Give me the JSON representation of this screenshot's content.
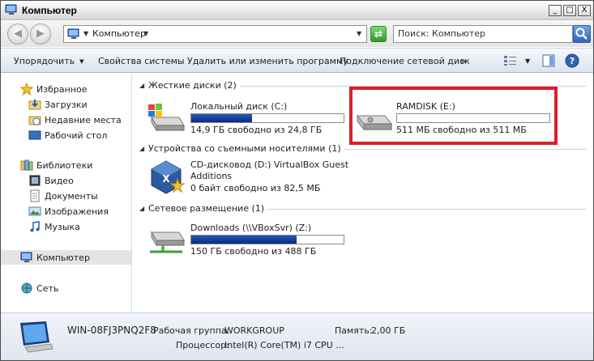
{
  "window": {
    "title": "Компьютер",
    "minimize": "_",
    "maximize": "□",
    "close": "X"
  },
  "address": {
    "path": "Компьютер",
    "search_placeholder": "Поиск: Компьютер"
  },
  "toolbar": {
    "organize": "Упорядочить",
    "system_properties": "Свойства системы",
    "uninstall": "Удалить или изменить программу",
    "map_drive": "Подключение сетевой диск",
    "more": "»"
  },
  "nav": {
    "favorites": "Избранное",
    "downloads": "Загрузки",
    "recent": "Недавние места",
    "desktop": "Рабочий стол",
    "libraries": "Библиотеки",
    "video": "Видео",
    "documents": "Документы",
    "images": "Изображения",
    "music": "Музыка",
    "computer": "Компьютер",
    "network": "Сеть"
  },
  "groups": {
    "hdd": "Жесткие диски (2)",
    "removable": "Устройства со съемными носителями (1)",
    "network": "Сетевое размещение (1)"
  },
  "drives": {
    "c": {
      "name": "Локальный диск (C:)",
      "free": "14,9 ГБ свободно из 24,8 ГБ",
      "used_fraction": 0.4
    },
    "e": {
      "name": "RAMDISK (E:)",
      "free": "511 МБ свободно из 511 МБ",
      "used_fraction": 0.0
    },
    "d": {
      "name_line1": "CD-дисковод (D:) VirtualBox Guest",
      "name_line2": "Additions",
      "free": "0 байт свободно из 82,5 МБ"
    },
    "z": {
      "name": "Downloads (\\\\VBoxSvr) (Z:)",
      "free": "150 ГБ свободно из 488 ГБ",
      "used_fraction": 0.69
    }
  },
  "details": {
    "computer_name": "WIN-08FJ3PNQ2F8",
    "workgroup_label": "Рабочая группа:",
    "workgroup": "WORKGROUP",
    "memory_label": "Память:",
    "memory": "2,00 ГБ",
    "cpu_label": "Процессор:",
    "cpu": "Intel(R) Core(TM) i7 CPU ..."
  },
  "colors": {
    "highlight": "#d9202a",
    "bar_fill": "#1a3f9c",
    "accent": "#2f65b8"
  }
}
